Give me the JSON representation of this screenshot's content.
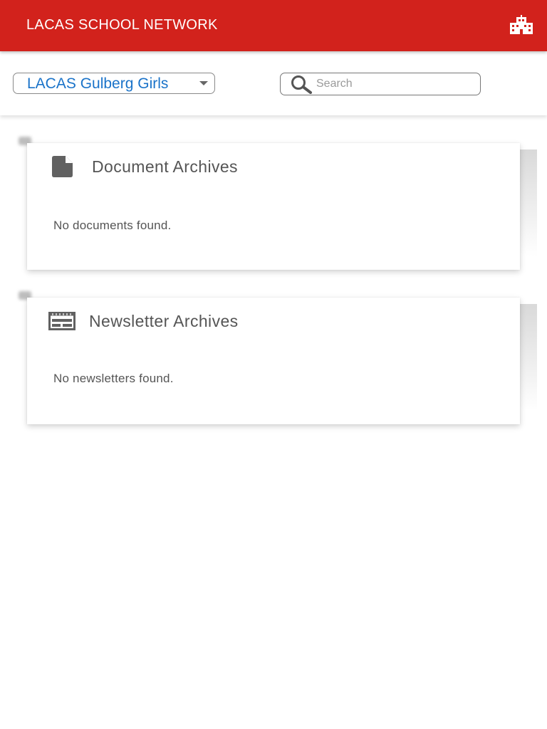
{
  "appbar": {
    "title": "LACAS SCHOOL NETWORK",
    "right_icon": "school-building-icon",
    "background": "#d2221c"
  },
  "filters": {
    "school_select": {
      "selected": "LACAS Gulberg Girls",
      "icon": "dropdown-arrow-icon"
    },
    "search": {
      "placeholder": "Search",
      "value": "",
      "icon": "search-icon"
    }
  },
  "sections": [
    {
      "title": "Document Archives",
      "icon": "document-icon",
      "empty_message": "No documents found."
    },
    {
      "title": "Newsletter Archives",
      "icon": "newsletter-icon",
      "empty_message": "No newsletters found."
    }
  ],
  "colors": {
    "accent": "#d2221c",
    "link": "#1a73c9",
    "text_secondary": "#555555"
  }
}
